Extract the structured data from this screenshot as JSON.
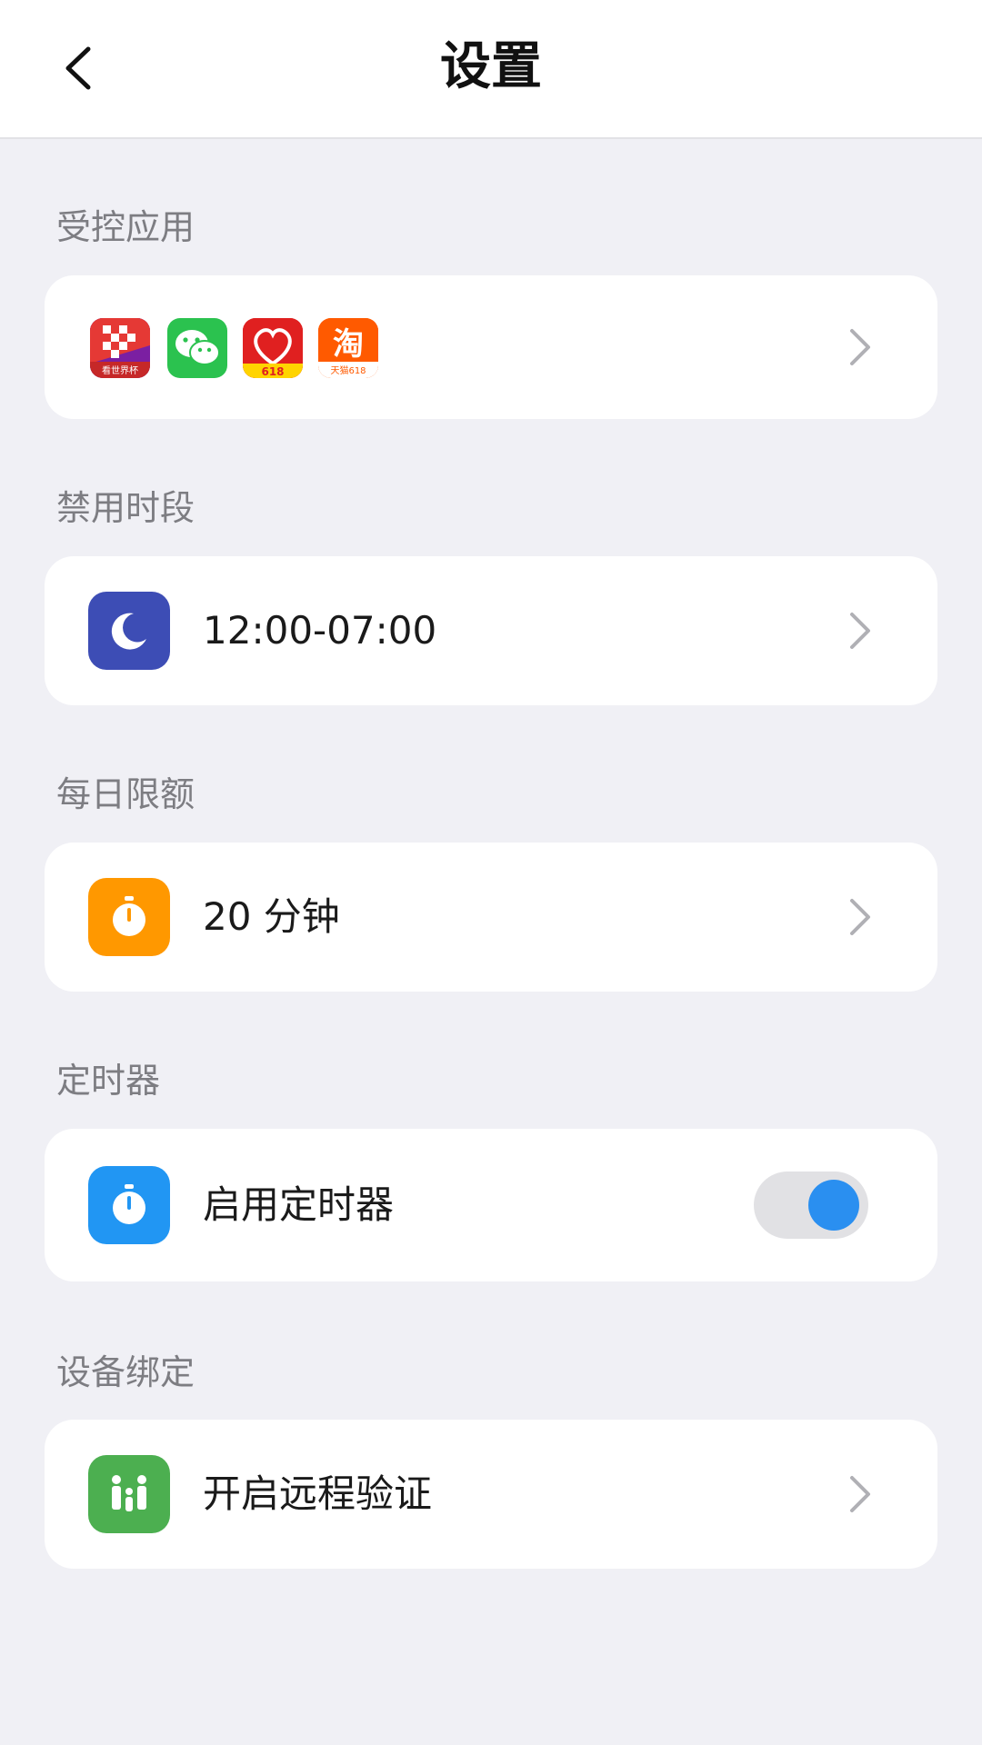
{
  "header": {
    "title": "设置"
  },
  "sections": {
    "controlled_apps": {
      "label": "受控应用",
      "apps": [
        {
          "name": "看世界杯",
          "icon": "worldcup-app-icon"
        },
        {
          "name": "微信",
          "icon": "wechat-app-icon"
        },
        {
          "name": "618",
          "icon": "pinduoduo-app-icon"
        },
        {
          "name": "淘",
          "icon": "taobao-app-icon",
          "sub": "天猫618"
        }
      ]
    },
    "disabled_period": {
      "label": "禁用时段",
      "value": "12:00-07:00",
      "icon": "moon-icon",
      "icon_color": "#3d4db5"
    },
    "daily_limit": {
      "label": "每日限额",
      "value": "20 分钟",
      "icon": "stopwatch-icon",
      "icon_color": "#ff9800"
    },
    "timer": {
      "label": "定时器",
      "value": "启用定时器",
      "icon": "stopwatch-icon",
      "icon_color": "#2196f3",
      "enabled": true
    },
    "device_binding": {
      "label": "设备绑定",
      "value": "开启远程验证",
      "icon": "family-icon",
      "icon_color": "#4caf50"
    }
  },
  "colors": {
    "accent": "#2a8ff0",
    "background": "#f0f0f5"
  }
}
